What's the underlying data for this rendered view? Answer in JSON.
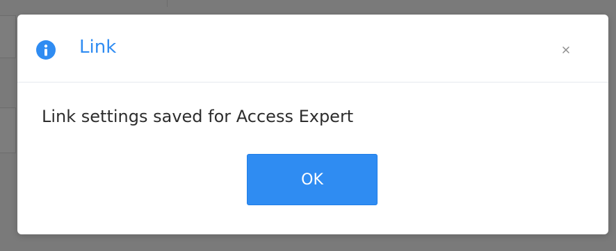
{
  "dialog": {
    "title": "Link",
    "message": "Link settings saved for Access Expert",
    "ok_label": "OK",
    "icon": "info-icon",
    "close_icon": "close-icon"
  },
  "colors": {
    "accent": "#2f8cf2",
    "overlay": "#7a7a7a",
    "text": "#2d2d2d"
  }
}
